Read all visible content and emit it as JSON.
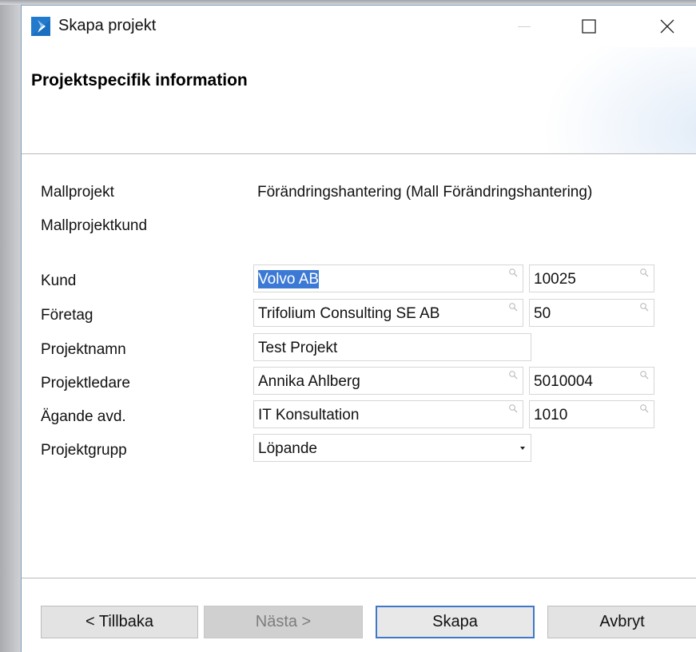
{
  "window": {
    "title": "Skapa projekt",
    "icons": {
      "app": "chevron-app-icon",
      "minimize": "minimize-icon",
      "maximize": "maximize-icon",
      "close": "close-icon"
    }
  },
  "header": {
    "page_title": "Projektspecifik information"
  },
  "info": {
    "mallprojekt_label": "Mallprojekt",
    "mallprojekt_value": "Förändringshantering (Mall Förändringshantering)",
    "mallprojektkund_label": "Mallprojektkund",
    "mallprojektkund_value": ""
  },
  "form": {
    "kund": {
      "label": "Kund",
      "name_value": "Volvo AB",
      "number_value": "10025"
    },
    "foretag": {
      "label": "Företag",
      "name_value": "Trifolium Consulting SE AB",
      "number_value": "50"
    },
    "projektnamn": {
      "label": "Projektnamn",
      "value": "Test Projekt"
    },
    "projektledare": {
      "label": "Projektledare",
      "name_value": "Annika Ahlberg",
      "number_value": "5010004"
    },
    "agande_avd": {
      "label": "Ägande avd.",
      "name_value": "IT Konsultation",
      "number_value": "1010"
    },
    "projektgrupp": {
      "label": "Projektgrupp",
      "selected": "Löpande"
    }
  },
  "buttons": {
    "back": "< Tillbaka",
    "next": "Nästa >",
    "create": "Skapa",
    "cancel": "Avbryt"
  },
  "colors": {
    "selection": "#3c79d4",
    "primary_border": "#3f77c9",
    "app_icon": "#1a6fc0"
  }
}
